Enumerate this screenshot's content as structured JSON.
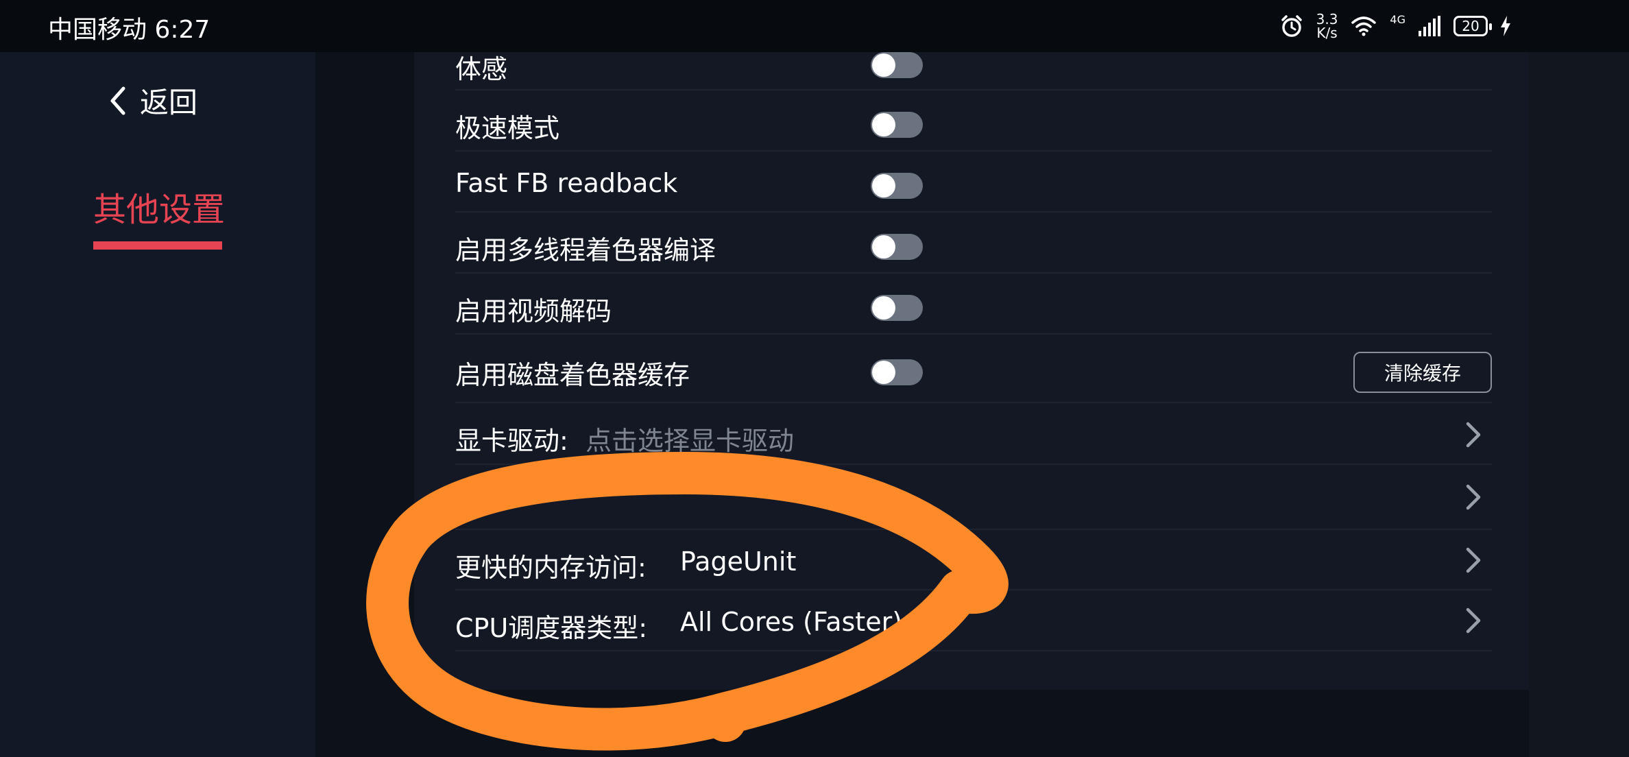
{
  "status_bar": {
    "carrier_time": "中国移动 6:27",
    "net_speed_value": "3.3",
    "net_speed_unit": "K/s",
    "network_label": "4G",
    "battery": "20"
  },
  "sidebar": {
    "back_label": "返回",
    "active_tab": "其他设置"
  },
  "settings": {
    "rows": [
      {
        "label": "体感",
        "toggle": false
      },
      {
        "label": "极速模式",
        "toggle": false
      },
      {
        "label": "Fast FB readback",
        "toggle": false
      },
      {
        "label": "启用多线程着色器编译",
        "toggle": false
      },
      {
        "label": "启用视频解码",
        "toggle": false
      },
      {
        "label": "启用磁盘着色器缓存",
        "toggle": false,
        "button": "清除缓存"
      },
      {
        "label": "显卡驱动:",
        "placeholder": "点击选择显卡驱动"
      },
      {
        "label": ""
      },
      {
        "label": "更快的内存访问:",
        "value": "PageUnit"
      },
      {
        "label": "CPU调度器类型:",
        "value": "All Cores (Faster)"
      }
    ]
  },
  "colors": {
    "accent": "#e64452",
    "annotation": "#ff8a2a",
    "toggle_off": "#6b7280"
  }
}
